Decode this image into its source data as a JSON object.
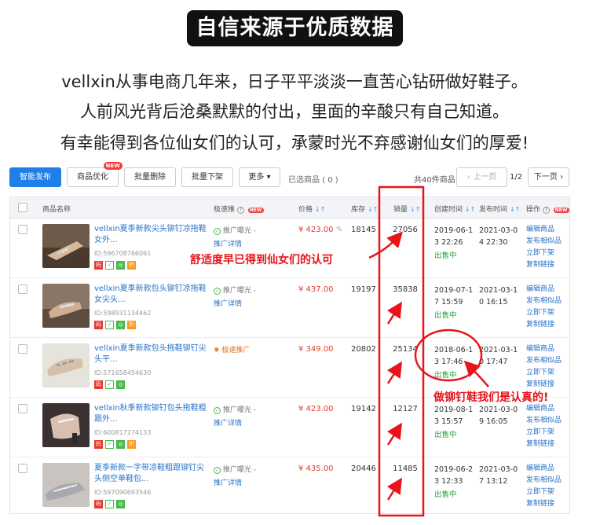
{
  "banner": {
    "title": "自信来源于优质数据"
  },
  "intro": {
    "line1": "vellxin从事电商几年来，日子平平淡淡一直苦心钻研做好鞋子。",
    "line2": "人前风光背后沧桑默默的付出，里面的辛酸只有自己知道。",
    "line3": "有幸能得到各位仙女们的认可，承蒙时光不弃感谢仙女们的厚爱!"
  },
  "toolbar": {
    "publish": "智能发布",
    "optimize": "商品优化",
    "optimize_badge": "NEW",
    "batch_delete": "批量删除",
    "batch_offshelf": "批量下架",
    "more": "更多 ▾",
    "selected": "已选商品 ( 0 )",
    "total": "共40件商品",
    "prev": "‹ 上一页",
    "page": "1/2",
    "next": "下一页 ›"
  },
  "table": {
    "headers": {
      "name": "商品名称",
      "promo": "极速推",
      "price": "价格",
      "stock": "库存",
      "sales": "销量",
      "created": "创建时间",
      "published": "发布时间",
      "ops": "操作"
    },
    "header_badge": "NEW",
    "rows": [
      {
        "title": "vellxin夏季新款尖头铆钉凉拖鞋女外...",
        "id": "ID:596708766061",
        "promo": "推广曝光 -",
        "promo_detail": "推广详情",
        "price": "¥ 423.00",
        "stock": "18145",
        "sales": "27056",
        "created": "2019-06-13 22:26",
        "status": "出售中",
        "published": "2021-03-04 22:30"
      },
      {
        "title": "vellxin夏季新款包头铆钉凉拖鞋女尖头...",
        "id": "ID:598931134462",
        "promo": "推广曝光 -",
        "promo_detail": "推广详情",
        "price": "¥ 437.00",
        "stock": "19197",
        "sales": "35838",
        "created": "2019-07-17 15:59",
        "status": "出售中",
        "published": "2021-03-10 16:15"
      },
      {
        "title": "vellxin夏季新款包头拖鞋铆钉尖头平...",
        "id": "ID:571658454630",
        "promo": "极速推广",
        "promo_detail": "",
        "price": "¥ 349.00",
        "stock": "20802",
        "sales": "25134",
        "created": "2018-06-13 17:46",
        "status": "出售中",
        "published": "2021-03-10 17:47"
      },
      {
        "title": "vellxin秋季新款铆钉包头拖鞋粗跟外...",
        "id": "ID:600817274133",
        "promo": "推广曝光 -",
        "promo_detail": "推广详情",
        "price": "¥ 423.00",
        "stock": "19142",
        "sales": "12127",
        "created": "2019-08-13 15:57",
        "status": "出售中",
        "published": "2021-03-09 16:05"
      },
      {
        "title": "夏季新款一字带凉鞋粗跟铆钉尖头侧空单鞋包...",
        "id": "ID:597090693546",
        "promo": "推广曝光 -",
        "promo_detail": "推广详情",
        "price": "¥ 435.00",
        "stock": "20446",
        "sales": "11485",
        "created": "2019-06-23 12:33",
        "status": "出售中",
        "published": "2021-03-07 13:12"
      }
    ],
    "ops": [
      "编辑商品",
      "发布相似品",
      "立即下架",
      "复制链接"
    ]
  },
  "annotations": {
    "comfort": "舒适度早已得到仙女们的认可",
    "serious": "做铆钉鞋我们是认真的!"
  },
  "colors": {
    "accent": "#1f7ee8",
    "price": "#e23b2e",
    "annotation": "#e8141a",
    "status": "#27a23b",
    "link": "#2a72c9"
  }
}
